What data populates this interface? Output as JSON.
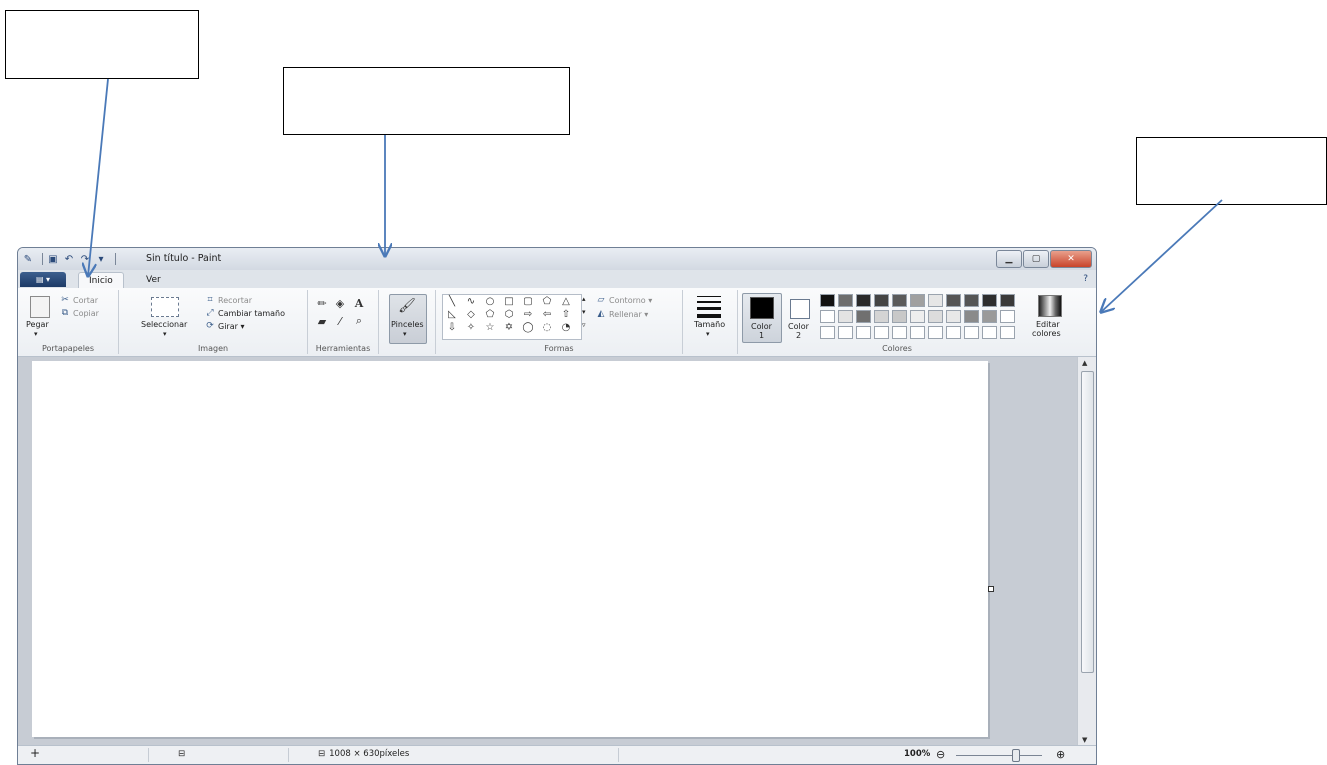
{
  "window": {
    "title": "Sin título - Paint"
  },
  "tabs": [
    "Inicio",
    "Ver"
  ],
  "ribbon": {
    "portapapeles": {
      "label": "Portapapeles",
      "paste": "Pegar",
      "cut": "Cortar",
      "copy": "Copiar"
    },
    "imagen": {
      "label": "Imagen",
      "select": "Seleccionar",
      "crop": "Recortar",
      "resize": "Cambiar tamaño",
      "rotate": "Girar"
    },
    "herramientas": {
      "label": "Herramientas"
    },
    "pinceles": {
      "label": "Pinceles"
    },
    "formas": {
      "label": "Formas",
      "outline": "Contorno",
      "fill": "Rellenar"
    },
    "tamano": {
      "label": "Tamaño"
    },
    "colores": {
      "label": "Colores",
      "color1": "Color",
      "color1_num": "1",
      "color2": "Color",
      "color2_num": "2",
      "edit_line1": "Editar",
      "edit_line2": "colores",
      "palette_row1": [
        "#111111",
        "#6d6d6d",
        "#2a2a2a",
        "#444444",
        "#5a5a5a",
        "#a0a0a0",
        "#e6e6e6",
        "#555555",
        "#555555",
        "#2e2e2e",
        "#3a3a3a"
      ],
      "palette_row2": [
        "#ffffff",
        "#e3e3e3",
        "#707070",
        "#d4d4d4",
        "#c8c8c8",
        "#eeeeee",
        "#dcdcdc",
        "#e8e8e8",
        "#8a8a8a",
        "#9a9a9a",
        "#ffffff"
      ],
      "palette_row3": [
        "#ffffff",
        "#ffffff",
        "#ffffff",
        "#ffffff",
        "#ffffff",
        "#ffffff",
        "#ffffff",
        "#ffffff",
        "#ffffff",
        "#ffffff",
        "#ffffff"
      ]
    }
  },
  "status": {
    "dimensions": "1008 × 630píxeles",
    "zoom": "100%"
  }
}
